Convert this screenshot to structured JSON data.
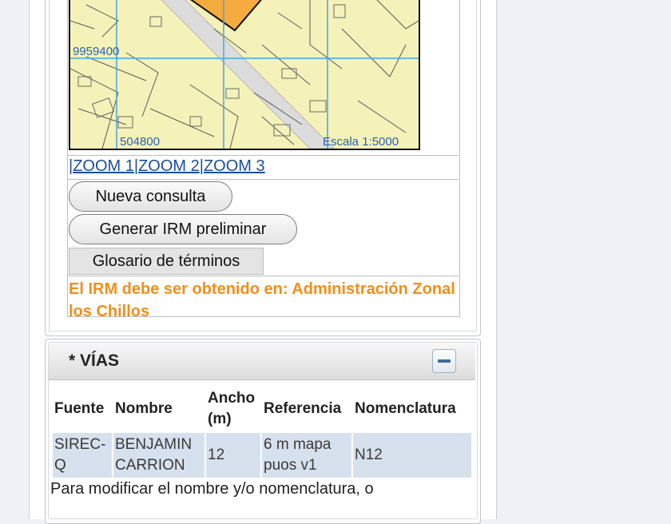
{
  "map": {
    "coord_y": "9959400",
    "coord_x": "504800",
    "scale": "Escala 1:5000"
  },
  "zoom": {
    "sep1": "|",
    "zoom1": "ZOOM 1",
    "sep2": "|",
    "zoom2": "ZOOM 2",
    "sep3": "|",
    "zoom3": "ZOOM 3"
  },
  "buttons": {
    "nueva_consulta": "Nueva consulta",
    "generar_irm": "Generar IRM preliminar",
    "glosario": "Glosario de términos"
  },
  "notice": "El IRM debe ser obtenido en: Administración Zonal los Chillos",
  "vias": {
    "title": "* VÍAS",
    "headers": [
      "Fuente",
      "Nombre",
      "Ancho (m)",
      "Referencia",
      "Nomenclatura"
    ],
    "rows": [
      [
        "SIREC-Q",
        "BENJAMIN CARRION",
        "12",
        "6 m mapa puos v1",
        "N12"
      ]
    ],
    "footnote": "Para modificar el nombre y/o nomenclatura, o"
  },
  "colors": {
    "map_bg": "#f4f2b8",
    "parcel_highlight": "#f6ab3e",
    "grid": "#4aa3de",
    "link": "#1b4e9a",
    "notice": "#ef8f1c",
    "table_cell": "#d7e1ee"
  }
}
